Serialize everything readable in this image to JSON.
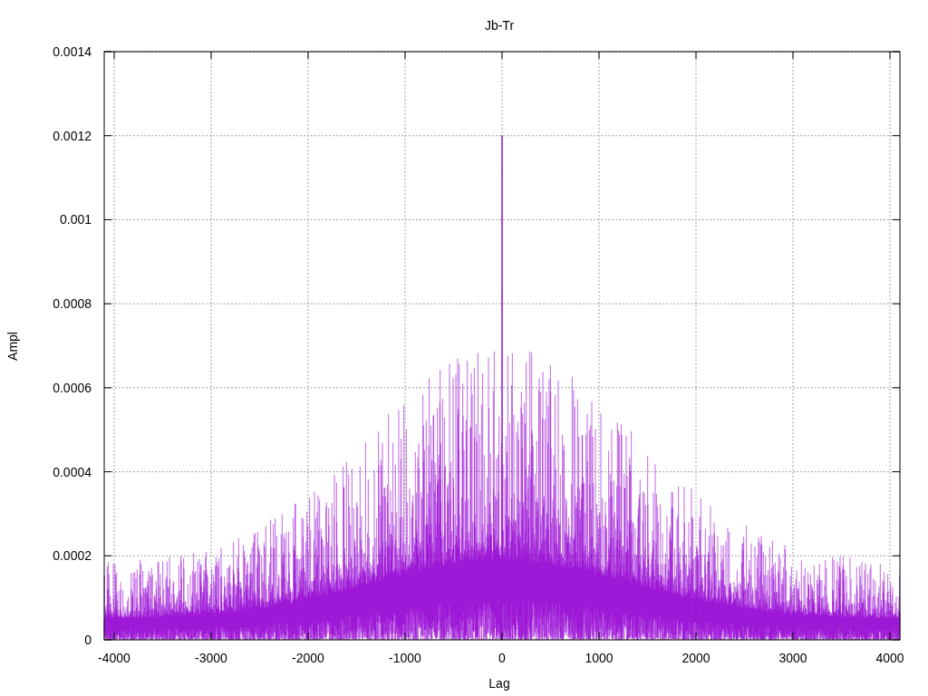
{
  "chart": {
    "title": "Jb-Tr",
    "xlabel": "Lag",
    "ylabel": "Ampl",
    "xticks": [
      "-4000",
      "-3000",
      "-2000",
      "-1000",
      "0",
      "1000",
      "2000",
      "3000",
      "4000"
    ],
    "yticks": [
      "0.0014",
      "0.0012",
      "0.001",
      "0.0008",
      "0.0006",
      "0.0004",
      "0.0002",
      "0"
    ]
  }
}
